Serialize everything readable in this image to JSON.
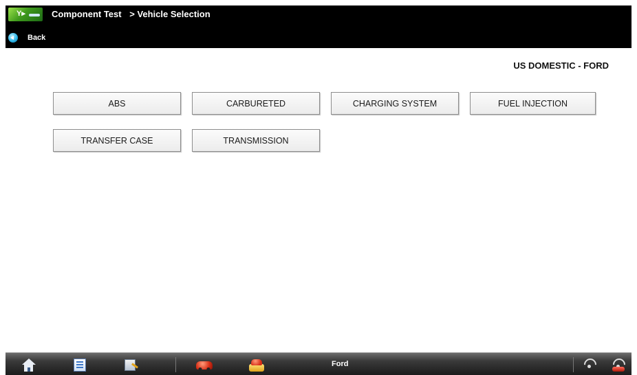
{
  "header": {
    "title": "Component Test",
    "breadcrumb_sep": ">",
    "breadcrumb_current": "Vehicle Selection",
    "back_label": "Back"
  },
  "region_label": "US DOMESTIC - FORD",
  "systems": [
    "ABS",
    "CARBURETED",
    "CHARGING SYSTEM",
    "FUEL INJECTION",
    "TRANSFER CASE",
    "TRANSMISSION"
  ],
  "toolbar": {
    "status_label": "Ford",
    "icons": [
      "home-icon",
      "list-icon",
      "tools-icon",
      "car-icon",
      "car-lift-icon",
      "signal-icon",
      "signal-alert-icon"
    ]
  },
  "colors": {
    "header_bg": "#000000",
    "button_border": "#8c8c8c",
    "toolbar_bg": "#2a2a2a"
  }
}
